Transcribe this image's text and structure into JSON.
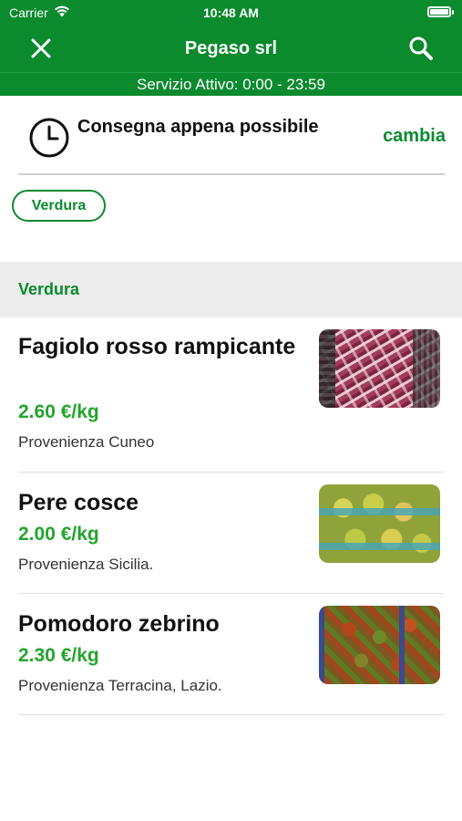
{
  "status_bar": {
    "carrier": "Carrier",
    "time": "10:48 AM"
  },
  "header": {
    "title": "Pegaso srl",
    "service": "Servizio Attivo: 0:00 - 23:59",
    "bg_color": "#0b8a2e"
  },
  "delivery": {
    "label": "Consegna appena possibile",
    "change_label": "cambia"
  },
  "categories": [
    "Verdura"
  ],
  "section": {
    "title": "Verdura"
  },
  "products": [
    {
      "name": "Fagiolo rosso rampicante",
      "price": "2.60 €/kg",
      "origin": "Provenienza Cuneo",
      "image": "red-beans-photo"
    },
    {
      "name": "Pere cosce",
      "price": "2.00 €/kg",
      "origin": "Provenienza Sicilia.",
      "image": "pears-photo"
    },
    {
      "name": "Pomodoro zebrino",
      "price": "2.30 €/kg",
      "origin": "Provenienza Terracina, Lazio.",
      "image": "tomatoes-photo"
    }
  ],
  "colors": {
    "accent": "#0b8a2e",
    "price": "#22a52c"
  }
}
